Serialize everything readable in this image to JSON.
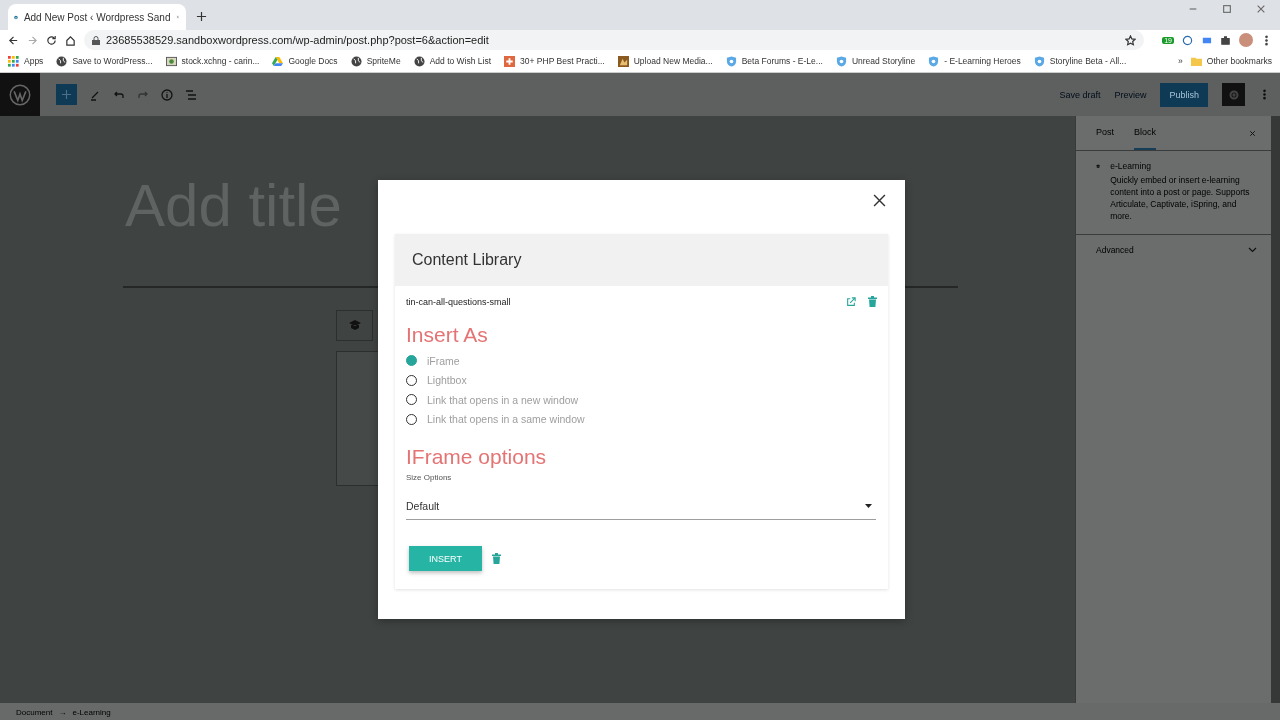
{
  "browser": {
    "tab_title": "Add New Post ‹ Wordpress Sand",
    "url": "23685538529.sandboxwordpress.com/wp-admin/post.php?post=6&action=edit",
    "extension_badge": "19",
    "bookmarks": [
      {
        "label": "Apps",
        "kind": "apps"
      },
      {
        "label": "Save to WordPress...",
        "kind": "globe"
      },
      {
        "label": "stock.xchng - carin...",
        "kind": "image"
      },
      {
        "label": "Google Docs",
        "kind": "drive"
      },
      {
        "label": "SpriteMe",
        "kind": "globe"
      },
      {
        "label": "Add to Wish List",
        "kind": "globe"
      },
      {
        "label": "30+ PHP Best Practi...",
        "kind": "plus"
      },
      {
        "label": "Upload New Media...",
        "kind": "photo"
      },
      {
        "label": "Beta Forums - E-Le...",
        "kind": "shield"
      },
      {
        "label": "Unread Storyline",
        "kind": "shield"
      },
      {
        "label": "- E-Learning Heroes",
        "kind": "shield"
      },
      {
        "label": "Storyline Beta - All...",
        "kind": "shield"
      }
    ],
    "more": "»",
    "other_bookmarks": "Other bookmarks"
  },
  "toolbar": {
    "save_draft": "Save draft",
    "preview": "Preview",
    "publish": "Publish"
  },
  "editor": {
    "title_placeholder": "Add title"
  },
  "sidebar": {
    "tabs": [
      {
        "label": "Post",
        "selected": false
      },
      {
        "label": "Block",
        "selected": true
      }
    ],
    "block_name": "e-Learning",
    "block_description": "Quickly embed or insert e-learning content into a post or page. Supports Articulate, Captivate, iSpring, and more.",
    "panels": [
      {
        "label": "Advanced",
        "expanded": false
      }
    ]
  },
  "modal": {
    "header": "Content Library",
    "item": "tin-can-all-questions-small",
    "insert_as_heading": "Insert As",
    "options": [
      {
        "label": "iFrame",
        "selected": true
      },
      {
        "label": "Lightbox",
        "selected": false
      },
      {
        "label": "Link that opens in a new window",
        "selected": false
      },
      {
        "label": "Link that opens in a same window",
        "selected": false
      }
    ],
    "iframe_heading": "IFrame options",
    "size_label": "Size Options",
    "size_value": "Default",
    "insert_button": "INSERT"
  },
  "breadcrumb": [
    "Document",
    "→",
    "e-Learning"
  ]
}
